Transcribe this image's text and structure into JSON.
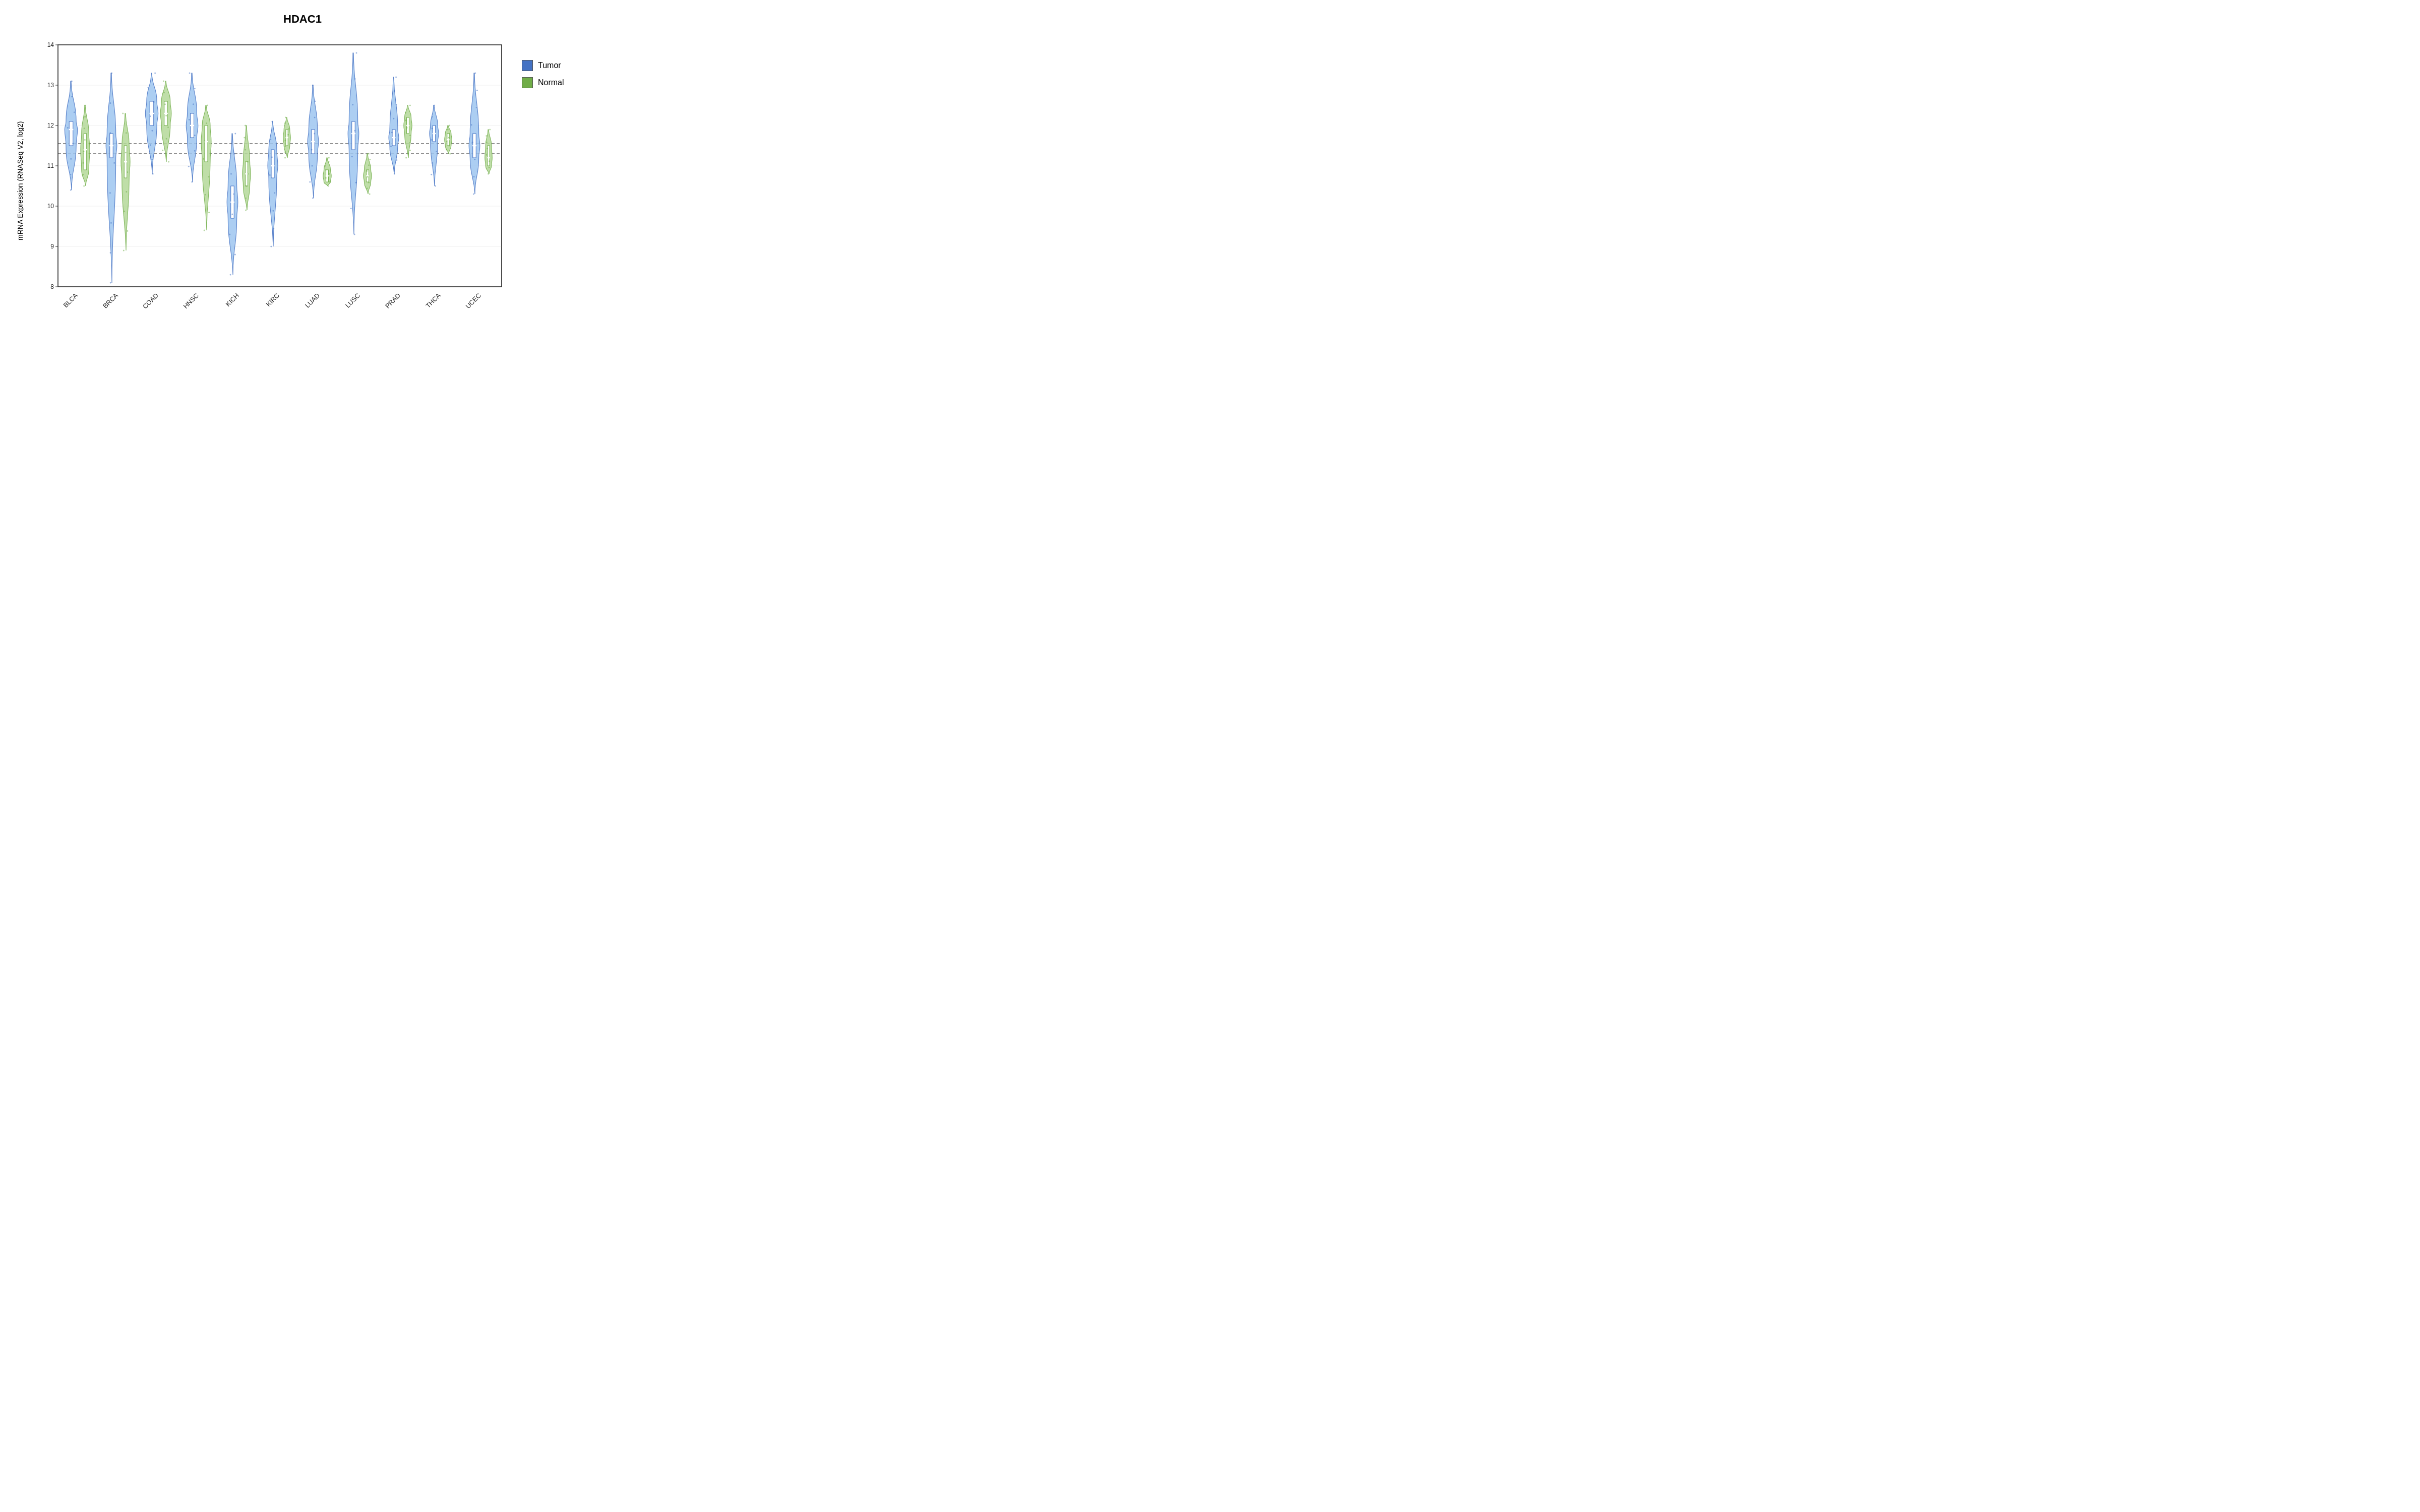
{
  "title": "HDAC1",
  "yAxisLabel": "mRNA Expression (RNASeq V2, log2)",
  "yTicks": [
    "8",
    "9",
    "10",
    "11",
    "12",
    "13",
    "14"
  ],
  "xLabels": [
    "BLCA",
    "BRCA",
    "COAD",
    "HNSC",
    "KICH",
    "KIRC",
    "LUAD",
    "LUSC",
    "PRAD",
    "THCA",
    "UCEC"
  ],
  "legend": {
    "items": [
      {
        "label": "Tumor",
        "color": "#4472C4"
      },
      {
        "label": "Normal",
        "color": "#70AD47"
      }
    ]
  },
  "dottedLines": [
    11.3,
    11.55
  ],
  "colors": {
    "tumor": "#4472C4",
    "normal": "#70AD47",
    "tumorLight": "#9EC6F0",
    "normalLight": "#B5D99A"
  },
  "violins": [
    {
      "cancer": "BLCA",
      "tumor": {
        "min": 10.4,
        "q1": 11.5,
        "median": 11.9,
        "q3": 12.1,
        "max": 13.1,
        "width": 0.7
      },
      "normal": {
        "min": 10.5,
        "q1": 10.9,
        "median": 11.4,
        "q3": 11.8,
        "max": 12.5,
        "width": 0.5
      }
    },
    {
      "cancer": "BRCA",
      "tumor": {
        "min": 8.1,
        "q1": 11.2,
        "median": 11.5,
        "q3": 11.8,
        "max": 13.3,
        "width": 0.6
      },
      "normal": {
        "min": 8.9,
        "q1": 10.7,
        "median": 11.1,
        "q3": 11.5,
        "max": 12.3,
        "width": 0.5
      }
    },
    {
      "cancer": "COAD",
      "tumor": {
        "min": 10.8,
        "q1": 12.0,
        "median": 12.3,
        "q3": 12.6,
        "max": 13.3,
        "width": 0.7
      },
      "normal": {
        "min": 11.1,
        "q1": 12.0,
        "median": 12.3,
        "q3": 12.6,
        "max": 13.1,
        "width": 0.6
      }
    },
    {
      "cancer": "HNSC",
      "tumor": {
        "min": 10.6,
        "q1": 11.7,
        "median": 12.0,
        "q3": 12.3,
        "max": 13.3,
        "width": 0.65
      },
      "normal": {
        "min": 9.4,
        "q1": 11.1,
        "median": 11.6,
        "q3": 12.0,
        "max": 12.5,
        "width": 0.55
      }
    },
    {
      "cancer": "KICH",
      "tumor": {
        "min": 8.3,
        "q1": 9.7,
        "median": 10.1,
        "q3": 10.5,
        "max": 11.8,
        "width": 0.6
      },
      "normal": {
        "min": 9.9,
        "q1": 10.5,
        "median": 10.8,
        "q3": 11.1,
        "max": 12.0,
        "width": 0.45
      }
    },
    {
      "cancer": "KIRC",
      "tumor": {
        "min": 9.0,
        "q1": 10.7,
        "median": 11.0,
        "q3": 11.4,
        "max": 12.1,
        "width": 0.55
      },
      "normal": {
        "min": 11.2,
        "q1": 11.5,
        "median": 11.7,
        "q3": 11.9,
        "max": 12.2,
        "width": 0.4
      }
    },
    {
      "cancer": "LUAD",
      "tumor": {
        "min": 10.2,
        "q1": 11.3,
        "median": 11.6,
        "q3": 11.9,
        "max": 13.0,
        "width": 0.6
      },
      "normal": {
        "min": 10.5,
        "q1": 10.6,
        "median": 10.75,
        "q3": 10.9,
        "max": 11.2,
        "width": 0.45
      }
    },
    {
      "cancer": "LUSC",
      "tumor": {
        "min": 9.3,
        "q1": 11.4,
        "median": 11.8,
        "q3": 12.1,
        "max": 13.8,
        "width": 0.6
      },
      "normal": {
        "min": 10.3,
        "q1": 10.6,
        "median": 10.75,
        "q3": 10.9,
        "max": 11.3,
        "width": 0.45
      }
    },
    {
      "cancer": "PRAD",
      "tumor": {
        "min": 10.8,
        "q1": 11.5,
        "median": 11.7,
        "q3": 11.9,
        "max": 13.2,
        "width": 0.55
      },
      "normal": {
        "min": 11.2,
        "q1": 11.8,
        "median": 12.0,
        "q3": 12.2,
        "max": 12.5,
        "width": 0.45
      }
    },
    {
      "cancer": "THCA",
      "tumor": {
        "min": 10.5,
        "q1": 11.6,
        "median": 11.8,
        "q3": 12.0,
        "max": 12.5,
        "width": 0.5
      },
      "normal": {
        "min": 11.3,
        "q1": 11.5,
        "median": 11.65,
        "q3": 11.8,
        "max": 12.0,
        "width": 0.4
      }
    },
    {
      "cancer": "UCEC",
      "tumor": {
        "min": 10.3,
        "q1": 11.2,
        "median": 11.5,
        "q3": 11.8,
        "max": 13.3,
        "width": 0.6
      },
      "normal": {
        "min": 10.8,
        "q1": 11.0,
        "median": 11.2,
        "q3": 11.5,
        "max": 11.9,
        "width": 0.4
      }
    }
  ]
}
